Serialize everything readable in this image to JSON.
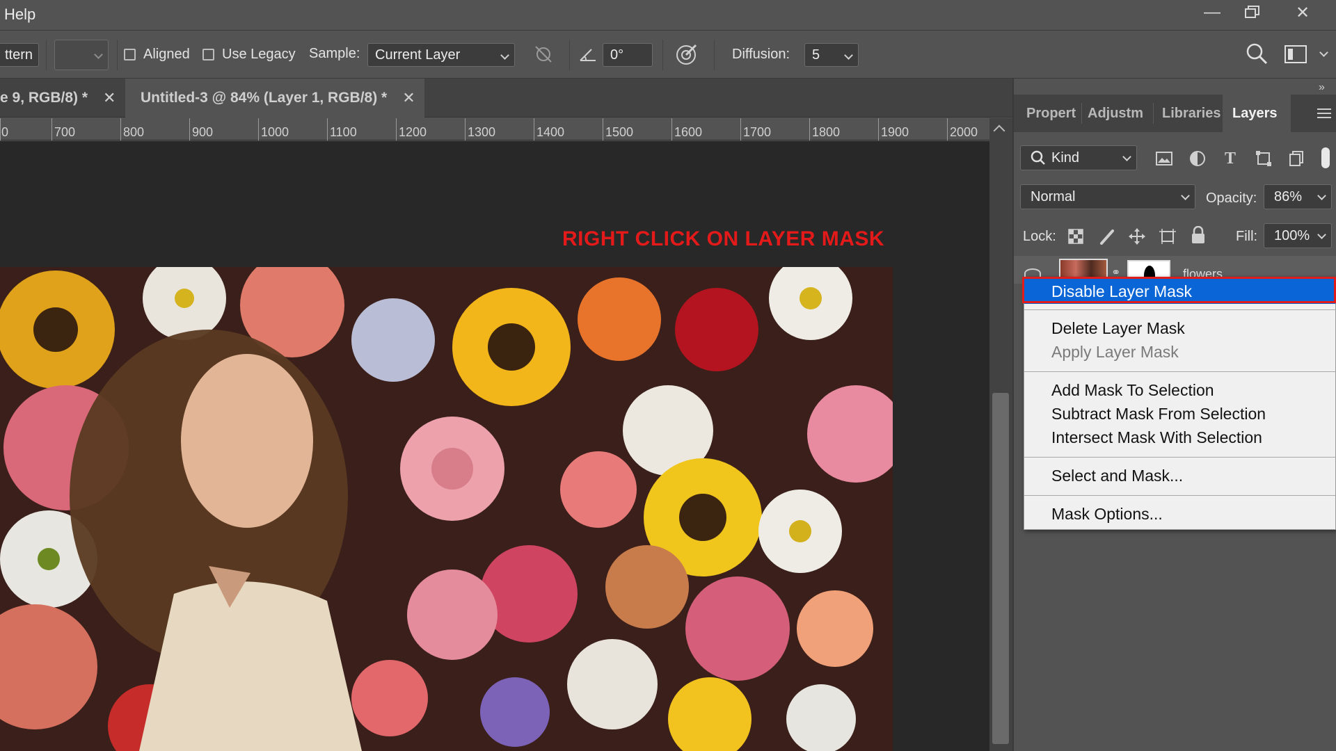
{
  "menubar": {
    "menu_items": [
      "Help"
    ],
    "window_controls": {
      "minimize": "minimize-icon",
      "restore": "restore-icon",
      "close": "close-icon"
    }
  },
  "options_bar": {
    "pattern_label": "ttern",
    "aligned_label": "Aligned",
    "aligned_checked": false,
    "use_legacy_label": "Use Legacy",
    "use_legacy_checked": false,
    "sample_label": "Sample:",
    "sample_value": "Current Layer",
    "angle_value": "0°",
    "diffusion_label": "Diffusion:",
    "diffusion_value": "5",
    "icons": [
      "pressure-off-icon",
      "angle-icon",
      "target-brush-icon",
      "search-icon",
      "workspace-icon"
    ]
  },
  "document_tabs": [
    {
      "label": "e 9, RGB/8) *",
      "active": false
    },
    {
      "label": "Untitled-3 @ 84% (Layer 1, RGB/8) *",
      "active": true
    }
  ],
  "ruler": {
    "labels": [
      "0",
      "700",
      "800",
      "900",
      "1000",
      "1100",
      "1200",
      "1300",
      "1400",
      "1500",
      "1600",
      "1700",
      "1800",
      "1900",
      "2000"
    ]
  },
  "canvas": {
    "annotation": "RIGHT CLICK ON LAYER MASK"
  },
  "panel": {
    "tabs": [
      "Properti",
      "Adjustm",
      "Libraries",
      "Layers"
    ],
    "active_tab": "Layers",
    "filter_kind": "Kind",
    "blend_mode": "Normal",
    "opacity_label": "Opacity:",
    "opacity_value": "86%",
    "lock_label": "Lock:",
    "fill_label": "Fill:",
    "fill_value": "100%",
    "layer_name": "flowers"
  },
  "context_menu": {
    "items": [
      {
        "label": "Disable Layer Mask",
        "highlighted": true,
        "enabled": true
      },
      {
        "label": "Delete Layer Mask",
        "highlighted": false,
        "enabled": true
      },
      {
        "label": "Apply Layer Mask",
        "highlighted": false,
        "enabled": false
      },
      {
        "label": "Add Mask To Selection",
        "highlighted": false,
        "enabled": true
      },
      {
        "label": "Subtract Mask From Selection",
        "highlighted": false,
        "enabled": true
      },
      {
        "label": "Intersect Mask With Selection",
        "highlighted": false,
        "enabled": true
      },
      {
        "label": "Select and Mask...",
        "highlighted": false,
        "enabled": true
      },
      {
        "label": "Mask Options...",
        "highlighted": false,
        "enabled": true
      }
    ]
  },
  "colors": {
    "annotation_red": "#e41a1a",
    "highlight_blue": "#0a66d6",
    "panel_bg": "#535353",
    "canvas_bg": "#282828"
  }
}
